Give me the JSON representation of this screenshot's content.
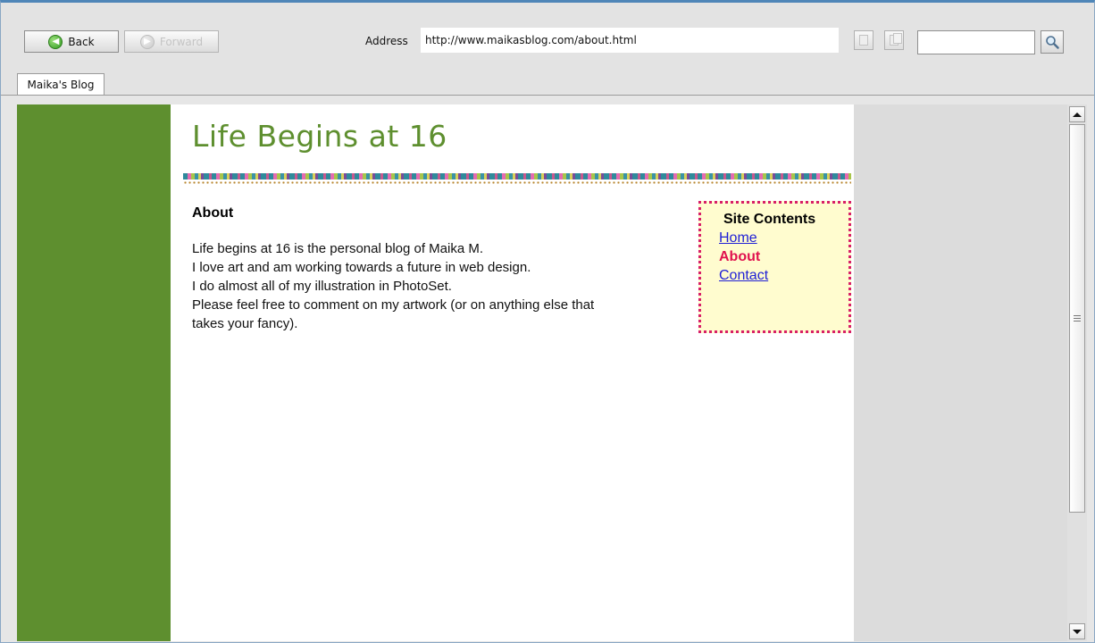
{
  "browser": {
    "back_label": "Back",
    "forward_label": "Forward",
    "address_label": "Address",
    "address_value": "http://www.maikasblog.com/about.html",
    "search_value": "",
    "tab_label": "Maika's Blog",
    "forward_disabled": true
  },
  "page": {
    "site_title": "Life Begins at 16",
    "section_heading": "About",
    "paragraph_lines": [
      "Life begins at 16 is the personal blog of Maika M.",
      "I love art and am working towards a future in web design.",
      "I do almost all of my illustration in PhotoSet.",
      "Please feel free to comment on my artwork (or on anything else that",
      "takes your fancy)."
    ],
    "sidebar": {
      "title": "Site Contents",
      "links": [
        "Home",
        "About",
        "Contact"
      ],
      "current_link": "About"
    }
  },
  "colors": {
    "brand_green": "#5e8f2f",
    "sidebar_border": "#d81f68",
    "sidebar_bg": "#fffccf",
    "current_link": "#e0114e",
    "link": "#1f1fd6"
  },
  "icons": {
    "back": "back-arrow-icon",
    "forward": "forward-arrow-icon",
    "copy": "copy-page-icon",
    "paste": "paste-page-icon",
    "search": "magnifier-icon"
  }
}
